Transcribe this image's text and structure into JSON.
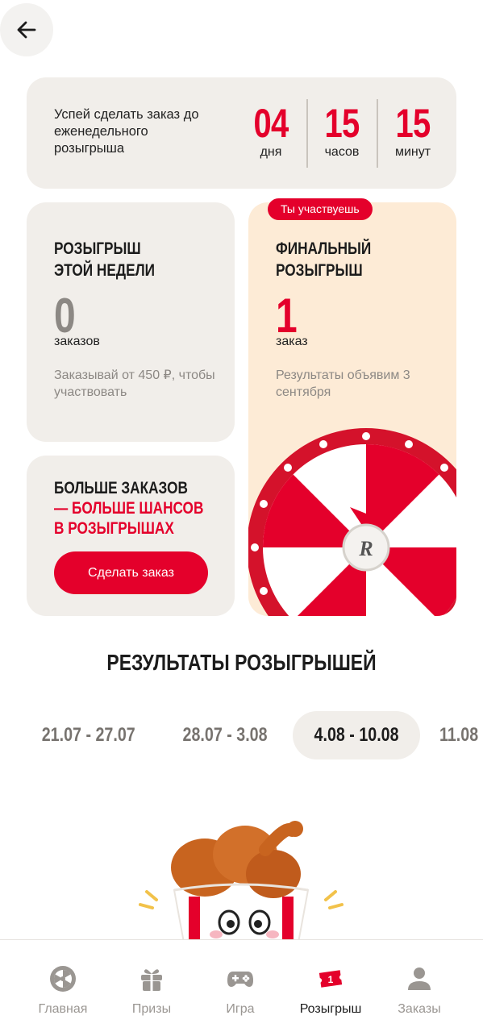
{
  "header": {
    "back_icon": "arrow-left-icon"
  },
  "countdown": {
    "text": "Успей сделать заказ до еженедельного розыгрыша",
    "days_value": "04",
    "days_label": "дня",
    "hours_value": "15",
    "hours_label": "часов",
    "minutes_value": "15",
    "minutes_label": "минут"
  },
  "week_card": {
    "title_line1": "Розыгрыш",
    "title_line2": "этой недели",
    "count": "0",
    "count_label": "заказов",
    "hint": "Заказывай от 450 ₽, чтобы участвовать"
  },
  "final_card": {
    "badge": "Ты участвуешь",
    "title_line1": "Финальный",
    "title_line2": "розыгрыш",
    "count": "1",
    "count_label": "заказ",
    "hint": "Результаты объявим 3 сентября"
  },
  "more_card": {
    "line1": "Больше заказов",
    "line2": "— больше шансов",
    "line3": "в розыгрышах",
    "button_label": "Сделать заказ"
  },
  "results": {
    "title": "Результаты розыгрышей",
    "tabs": [
      {
        "label": "21.07 - 27.07",
        "active": false
      },
      {
        "label": "28.07 - 3.08",
        "active": false
      },
      {
        "label": "4.08 - 10.08",
        "active": true
      },
      {
        "label": "11.08",
        "active": false
      }
    ]
  },
  "bottom_nav": {
    "items": [
      {
        "label": "Главная",
        "icon": "wheel-icon",
        "active": false
      },
      {
        "label": "Призы",
        "icon": "gift-icon",
        "active": false
      },
      {
        "label": "Игра",
        "icon": "gamepad-icon",
        "active": false
      },
      {
        "label": "Розыгрыш",
        "icon": "ticket-icon",
        "active": true
      },
      {
        "label": "Заказы",
        "icon": "user-icon",
        "active": false
      }
    ]
  },
  "colors": {
    "accent": "#e4002b",
    "card_bg": "#f1eeea",
    "final_bg": "#fdebd6"
  }
}
